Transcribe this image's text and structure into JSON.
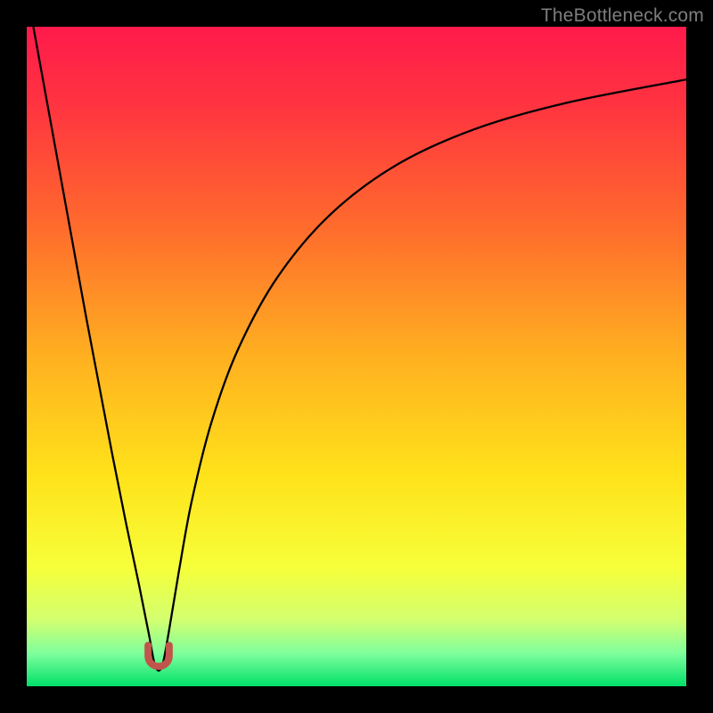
{
  "watermark": "TheBottleneck.com",
  "chart_data": {
    "type": "line",
    "title": "",
    "xlabel": "",
    "ylabel": "",
    "xlim": [
      0,
      100
    ],
    "ylim": [
      0,
      100
    ],
    "grid": false,
    "legend": false,
    "background_gradient": {
      "stops": [
        {
          "offset": 0.0,
          "color": "#ff1a4b"
        },
        {
          "offset": 0.12,
          "color": "#ff3440"
        },
        {
          "offset": 0.3,
          "color": "#ff6a2d"
        },
        {
          "offset": 0.5,
          "color": "#ffb020"
        },
        {
          "offset": 0.68,
          "color": "#ffe21a"
        },
        {
          "offset": 0.82,
          "color": "#f6ff3a"
        },
        {
          "offset": 0.9,
          "color": "#d2ff70"
        },
        {
          "offset": 0.95,
          "color": "#7fff9c"
        },
        {
          "offset": 1.0,
          "color": "#00e06a"
        }
      ]
    },
    "series": [
      {
        "name": "bottleneck-curve",
        "stroke": "#000000",
        "stroke_width": 2.3,
        "x": [
          1.0,
          3.0,
          5.0,
          7.0,
          9.0,
          11.0,
          13.0,
          15.0,
          17.0,
          18.5,
          19.5,
          20.5,
          21.5,
          23.0,
          25.0,
          28.0,
          32.0,
          38.0,
          46.0,
          56.0,
          68.0,
          82.0,
          100.0
        ],
        "y": [
          100.0,
          89.0,
          78.0,
          67.0,
          56.0,
          45.5,
          35.0,
          25.0,
          15.5,
          8.0,
          3.0,
          3.0,
          8.0,
          17.0,
          28.0,
          40.0,
          51.0,
          62.0,
          71.5,
          79.0,
          84.5,
          88.5,
          92.0
        ]
      }
    ],
    "markers": [
      {
        "name": "bottleneck-marker",
        "shape": "u",
        "x": 20.0,
        "y": 3.0,
        "width": 3.2,
        "height": 3.2,
        "stroke": "#c1544b",
        "stroke_width": 8
      }
    ]
  }
}
